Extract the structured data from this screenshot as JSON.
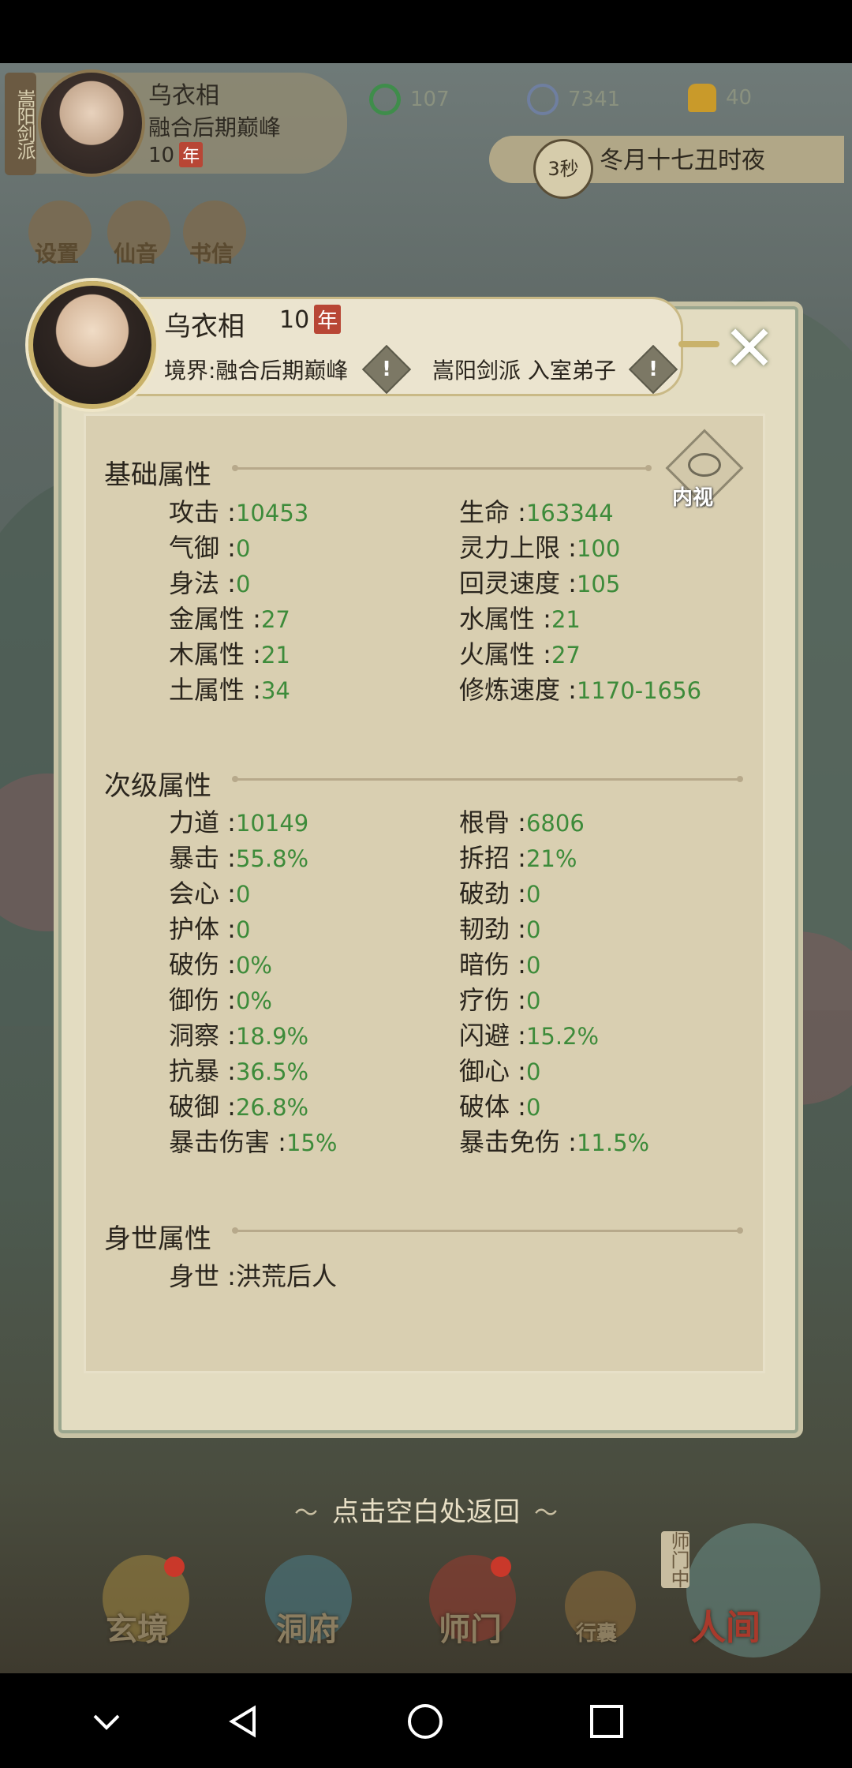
{
  "hud": {
    "sect_tab": "嵩阳剑派",
    "player_name": "乌衣相",
    "realm": "融合后期巅峰",
    "age_number": "10",
    "age_unit": "年",
    "resources": [
      {
        "icon": "jade-swirl-icon",
        "value": "107",
        "color": "#3f8d4b"
      },
      {
        "icon": "coin-icon",
        "value": "7341",
        "color": "#6f7fa0"
      },
      {
        "icon": "ingot-icon",
        "value": "40",
        "color": "#c99a2a"
      }
    ],
    "timer": "3秒",
    "game_time": "冬月十七丑时夜",
    "buttons": [
      "设置",
      "仙音",
      "书信"
    ]
  },
  "dialog": {
    "name": "乌衣相",
    "age_number": "10",
    "age_unit": "年",
    "realm_label": "境界:融合后期巅峰",
    "sect_label": "嵩阳剑派 入室弟子",
    "inner_view_label": "内视",
    "sections": {
      "basic": {
        "title": "基础属性",
        "left": [
          {
            "k": "攻击 :",
            "v": "10453"
          },
          {
            "k": "气御 :",
            "v": "0"
          },
          {
            "k": "身法 :",
            "v": "0"
          },
          {
            "k": "金属性 :",
            "v": "27"
          },
          {
            "k": "木属性 :",
            "v": "21"
          },
          {
            "k": "土属性 :",
            "v": "34"
          }
        ],
        "right": [
          {
            "k": "生命 :",
            "v": "163344"
          },
          {
            "k": "灵力上限 :",
            "v": "100"
          },
          {
            "k": "回灵速度 :",
            "v": "105"
          },
          {
            "k": "水属性 :",
            "v": "21"
          },
          {
            "k": "火属性 :",
            "v": "27"
          },
          {
            "k": "修炼速度 :",
            "v": "1170-1656"
          }
        ]
      },
      "secondary": {
        "title": "次级属性",
        "left": [
          {
            "k": "力道 :",
            "v": "10149"
          },
          {
            "k": "暴击 :",
            "v": "55.8%"
          },
          {
            "k": "会心 :",
            "v": "0"
          },
          {
            "k": "护体 :",
            "v": "0"
          },
          {
            "k": "破伤 :",
            "v": "0%"
          },
          {
            "k": "御伤 :",
            "v": "0%"
          },
          {
            "k": "洞察 :",
            "v": "18.9%"
          },
          {
            "k": "抗暴 :",
            "v": "36.5%"
          },
          {
            "k": "破御 :",
            "v": "26.8%"
          },
          {
            "k": "暴击伤害 :",
            "v": "15%"
          }
        ],
        "right": [
          {
            "k": "根骨 :",
            "v": "6806"
          },
          {
            "k": "拆招 :",
            "v": "21%"
          },
          {
            "k": "破劲 :",
            "v": "0"
          },
          {
            "k": "韧劲 :",
            "v": "0"
          },
          {
            "k": "暗伤 :",
            "v": "0"
          },
          {
            "k": "疗伤 :",
            "v": "0"
          },
          {
            "k": "闪避 :",
            "v": "15.2%"
          },
          {
            "k": "御心 :",
            "v": "0"
          },
          {
            "k": "破体 :",
            "v": "0"
          },
          {
            "k": "暴击免伤 :",
            "v": "11.5%"
          }
        ]
      },
      "background": {
        "title": "身世属性",
        "item": {
          "k": "身世 :",
          "v": "洪荒后人"
        }
      }
    }
  },
  "return_hint": "点击空白处返回",
  "bottom_nav": [
    {
      "label": "玄境",
      "icon": "scroll-icon",
      "badge": true
    },
    {
      "label": "洞府",
      "icon": "pavilion-icon",
      "badge": false
    },
    {
      "label": "师门",
      "icon": "banner-icon",
      "badge": true
    },
    {
      "label": "行囊",
      "icon": "bag-icon",
      "badge": false
    },
    {
      "label": "人间",
      "icon": "world-icon",
      "badge": false
    }
  ],
  "master_side_label": "师门中",
  "colors": {
    "attribute_value": "#3d8b3a",
    "panel_bg": "#d9cfb1",
    "accent_badge": "#b84635"
  }
}
